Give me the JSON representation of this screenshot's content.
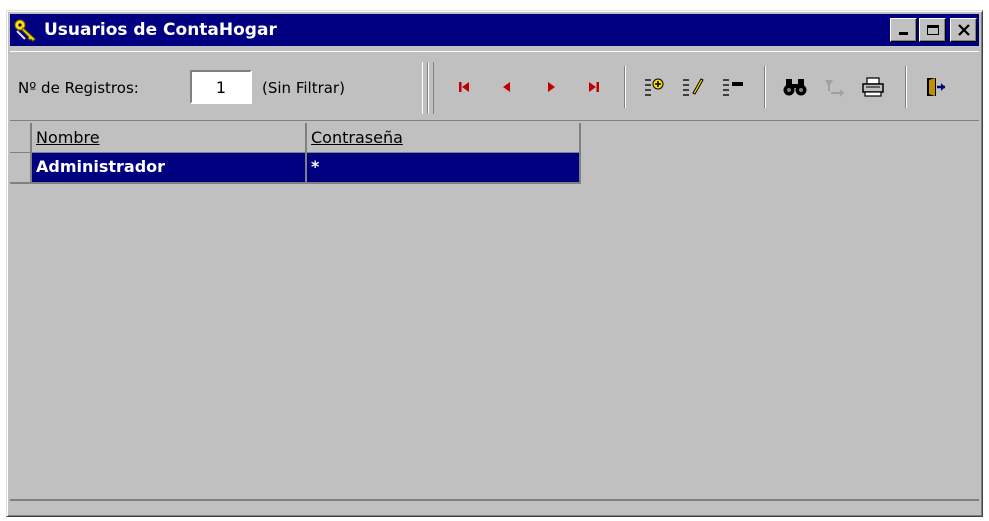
{
  "window": {
    "title": "Usuarios de ContaHogar",
    "title_icon": "keys-icon",
    "buttons": [
      "minimize",
      "maximize",
      "close"
    ]
  },
  "toolbar": {
    "records_label": "Nº de Registros:",
    "records_value": "1",
    "filter_status": "(Sin Filtrar)",
    "tools": [
      {
        "name": "first-record",
        "icon": "first-record-icon"
      },
      {
        "name": "previous-record",
        "icon": "previous-record-icon"
      },
      {
        "name": "next-record",
        "icon": "next-record-icon"
      },
      {
        "name": "last-record",
        "icon": "last-record-icon"
      },
      {
        "name": "add-record",
        "icon": "add-record-icon"
      },
      {
        "name": "edit-record",
        "icon": "edit-record-icon"
      },
      {
        "name": "delete-record",
        "icon": "delete-record-icon"
      },
      {
        "name": "search",
        "icon": "binoculars-icon"
      },
      {
        "name": "filter",
        "icon": "filter-icon"
      },
      {
        "name": "print",
        "icon": "printer-icon"
      },
      {
        "name": "exit",
        "icon": "exit-door-icon"
      }
    ]
  },
  "grid": {
    "columns": [
      "Nombre",
      "Contraseña"
    ],
    "rows": [
      {
        "nombre": "Administrador",
        "contrasena": "*",
        "selected": true
      }
    ]
  },
  "colors": {
    "titlebar": "#000080",
    "selection": "#000080",
    "face": "#c0c0c0",
    "nav_arrows": "#c00000"
  }
}
